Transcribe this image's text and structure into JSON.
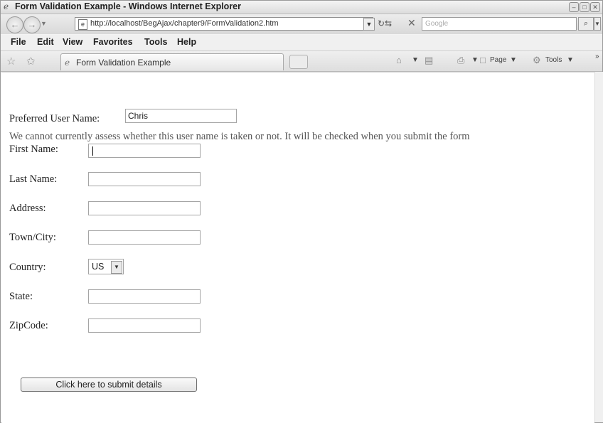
{
  "window": {
    "title": "Form Validation Example - Windows Internet Explorer",
    "controls": [
      "minimize",
      "maximize",
      "close"
    ]
  },
  "addressbar": {
    "url": "http://localhost/BegAjax/chapter9/FormValidation2.htm",
    "search_placeholder": "Google"
  },
  "menu": [
    "File",
    "Edit",
    "View",
    "Favorites",
    "Tools",
    "Help"
  ],
  "tab": {
    "label": "Form Validation Example"
  },
  "commandbar": {
    "page_label": "Page",
    "tools_label": "Tools"
  },
  "form": {
    "username_label": "Preferred User Name:",
    "username_value": "Chris",
    "username_note": "We cannot currently assess whether this user name is taken or not. It will be checked when you submit the form",
    "first_name_label": "First Name:",
    "last_name_label": "Last Name:",
    "address_label": "Address:",
    "town_label": "Town/City:",
    "country_label": "Country:",
    "country_value": "US",
    "state_label": "State:",
    "zip_label": "ZipCode:",
    "submit_label": "Click here to submit details"
  }
}
